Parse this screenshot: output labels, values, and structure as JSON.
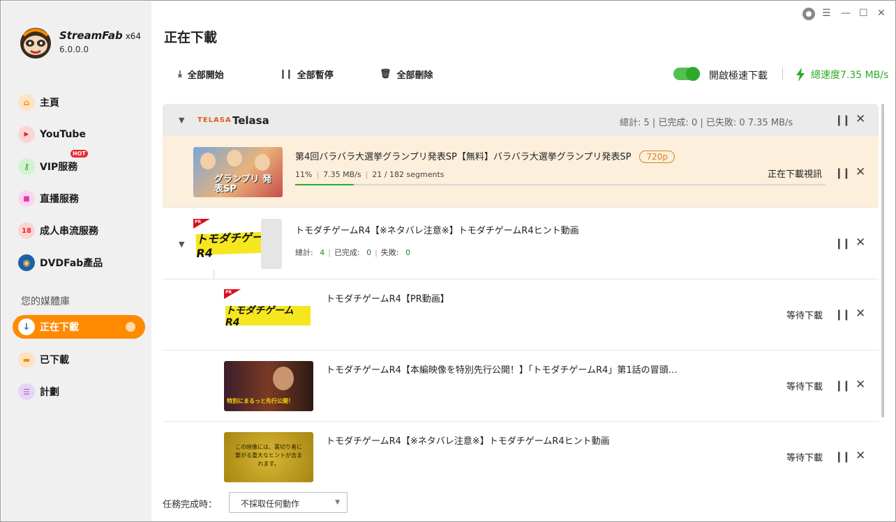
{
  "app": {
    "brand": "StreamFab",
    "arch": "x64",
    "version": "6.0.0.0"
  },
  "sidebar": {
    "items": [
      {
        "label": "主頁",
        "icon": "home-icon"
      },
      {
        "label": "YouTube",
        "icon": "youtube-icon"
      },
      {
        "label": "VIP服務",
        "icon": "key-icon",
        "badge": "HOT"
      },
      {
        "label": "直播服務",
        "icon": "live-camera-icon"
      },
      {
        "label": "成人串流服務",
        "icon": "adult-18-icon"
      },
      {
        "label": "DVDFab產品",
        "icon": "dvdfab-icon"
      }
    ],
    "library_label": "您的媒體庫",
    "library": [
      {
        "label": "正在下載",
        "icon": "download-icon",
        "active": true
      },
      {
        "label": "已下載",
        "icon": "folder-icon"
      },
      {
        "label": "計劃",
        "icon": "schedule-icon"
      }
    ]
  },
  "header": {
    "title": "正在下載"
  },
  "toolbar": {
    "start_all": "全部開始",
    "pause_all": "全部暫停",
    "delete_all": "全部刪除",
    "fast_download_label": "開啟極速下載",
    "fast_download_on": true,
    "total_speed": "總速度7.35 MB/s"
  },
  "group": {
    "service_logo": "TELASA",
    "name": "Telasa",
    "stats": "總計: 5 | 已完成: 0 | 已失敗: 0    7.35 MB/s"
  },
  "active_item": {
    "title": "第4回バラバラ大選挙グランプリ発表SP【無料】バラバラ大選挙グランプリ発表SP",
    "resolution": "720p",
    "percent": "11%",
    "speed": "7.35 MB/s",
    "segments": "21 / 182 segments",
    "progress": 0.11,
    "status": "正在下載視訊",
    "thumb_text": "グランプリ 発表SP"
  },
  "sub_group": {
    "title": "トモダチゲームR4【※ネタバレ注意※】トモダチゲームR4ヒント動画",
    "total_label": "總計:",
    "total": "4",
    "done_label": "已完成:",
    "done": "0",
    "failed_label": "失敗:",
    "failed": "0",
    "logo_text": "トモダチゲーム R4",
    "pr": "PR"
  },
  "sub_items": [
    {
      "title": "トモダチゲームR4【PR動画】",
      "status": "等待下載",
      "thumb_text": "トモダチゲーム R4",
      "pr": "PR"
    },
    {
      "title": "トモダチゲームR4【本編映像を特別先行公開！】「トモダチゲームR4」第1話の冒頭…",
      "status": "等待下載",
      "thumb_text": "特別にまるっと先行公開！"
    },
    {
      "title": "トモダチゲームR4【※ネタバレ注意※】トモダチゲームR4ヒント動画",
      "status": "等待下載",
      "thumb_text": "この映像には、裏切り者に繋がる重大なヒントが含まれます。"
    }
  ],
  "footer": {
    "on_complete_label": "任務完成時：",
    "on_complete_value": "不採取任何動作"
  },
  "colors": {
    "accent": "#ff8a00",
    "green": "#2eaa2a",
    "active_row": "#fcefdb"
  }
}
